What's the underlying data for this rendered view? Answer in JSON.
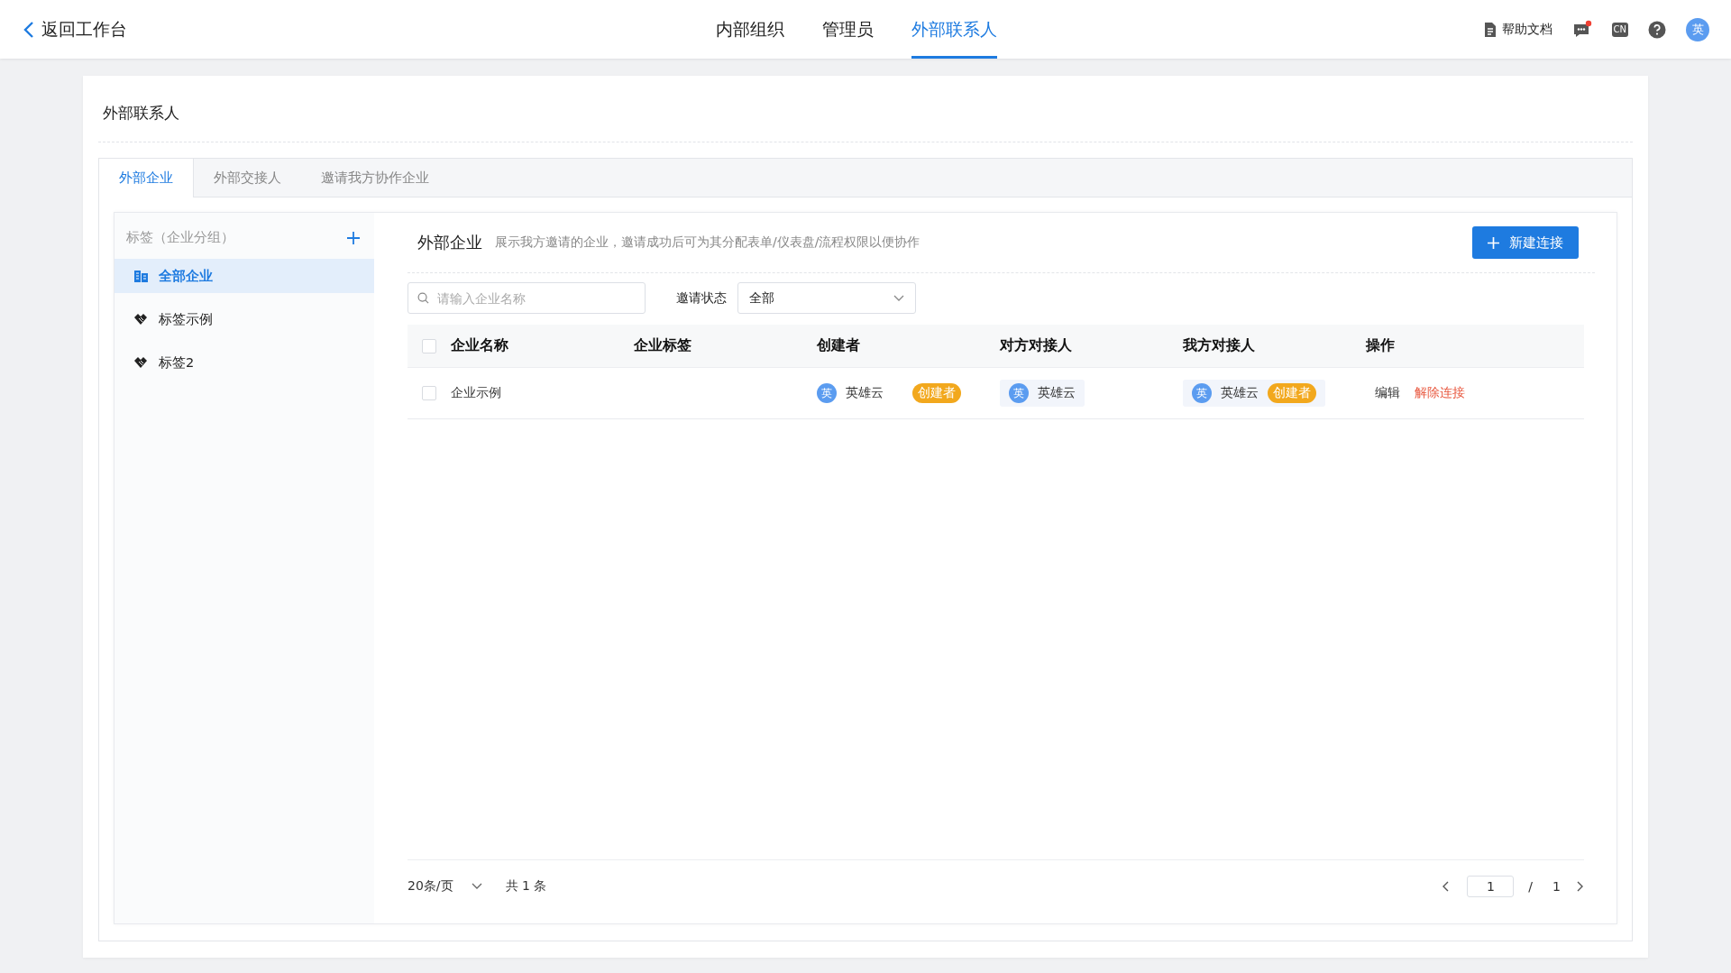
{
  "top_bar": {
    "back_link": "返回工作台",
    "nav_tabs": [
      {
        "label": "内部组织",
        "selected": false
      },
      {
        "label": "管理员",
        "selected": false
      },
      {
        "label": "外部联系人",
        "selected": true
      }
    ],
    "help_link": "帮助文档",
    "messages_unread": true,
    "language": "CN",
    "avatar": "英"
  },
  "card": {
    "title": "外部联系人",
    "tabs": [
      {
        "label": "外部企业",
        "selected": true
      },
      {
        "label": "外部交接人",
        "selected": false
      },
      {
        "label": "邀请我方协作企业",
        "selected": false
      }
    ],
    "sidebar": {
      "title": "标签（企业分组）",
      "items": [
        {
          "label": "全部企业",
          "kind": "all",
          "selected": true
        },
        {
          "label": "标签示例",
          "kind": "tag",
          "selected": false
        },
        {
          "label": "标签2",
          "kind": "tag",
          "selected": false
        }
      ]
    },
    "main": {
      "title": "外部企业",
      "description": "展示我方邀请的企业，邀请成功后可为其分配表单/仪表盘/流程权限以便协作",
      "new_button": "新建连接",
      "search": {
        "placeholder": "请输入企业名称"
      },
      "filter": {
        "label": "邀请状态",
        "value": "全部"
      },
      "table": {
        "select_all_checked": false,
        "columns": [
          "企业名称",
          "企业标签",
          "创建者",
          "对方对接人",
          "我方对接人",
          "操作"
        ],
        "rows": [
          {
            "checked": false,
            "name": "企业示例",
            "creator": {
              "avatar": "英",
              "name": "英雄云",
              "badge": "创建者"
            },
            "counterpart": {
              "avatar": "英",
              "name": "英雄云"
            },
            "our_contact": {
              "avatar": "英",
              "name": "英雄云",
              "badge": "创建者"
            },
            "actions": [
              {
                "label": "编辑",
                "kind": "normal"
              },
              {
                "label": "解除连接",
                "kind": "danger"
              }
            ]
          }
        ]
      },
      "pagination": {
        "page_size": "20条/页",
        "total": "共 1 条",
        "current_page": "1",
        "separator": "/",
        "total_pages": "1"
      }
    }
  }
}
